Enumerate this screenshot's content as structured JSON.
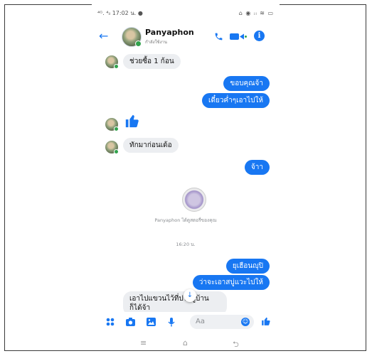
{
  "status_bar": {
    "time": "17:02 น.",
    "left_signal": "⁴ᴳ. ⁴ᵢₗ",
    "right_icons": "⌂ ◉ ᵢₗ ≋ ▭"
  },
  "header": {
    "contact_name": "Panyaphon",
    "contact_status": "กำลังใช้งาน",
    "accent": "#1877f2"
  },
  "messages": [
    {
      "side": "in",
      "text": "ช่วยซื้อ 1 ก้อน"
    },
    {
      "side": "out",
      "text": "ขอบคุณจ้า"
    },
    {
      "side": "out",
      "text": "เดี๋ยวค่ำๆเอาไปให้"
    },
    {
      "side": "in",
      "type": "like"
    },
    {
      "side": "in",
      "text": "ทักมาก่อนเด้อ"
    },
    {
      "side": "out",
      "text": "จ้าา"
    },
    {
      "side": "out",
      "text": "ยุเฮือนญุปิ"
    },
    {
      "side": "out",
      "text": "ว่าจะเอาสบู่แวะไปให้"
    },
    {
      "side": "in",
      "text": "เอาไปแขวนไว้ที่ประตูบ้านก็ได้จ้า"
    }
  ],
  "system": {
    "sticker_note": "Panyaphon ได้ดูสตอรี่ของคุณ",
    "time_divider": "16:20 น."
  },
  "composer": {
    "placeholder": "Aa"
  },
  "nav": {
    "menu": "≡",
    "home": "⌂",
    "back": "⮌"
  }
}
